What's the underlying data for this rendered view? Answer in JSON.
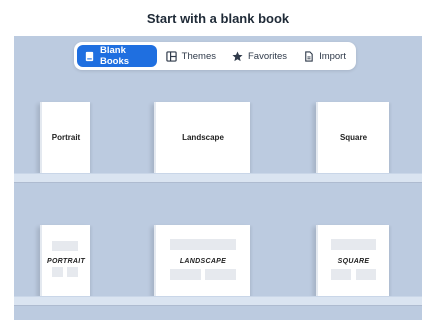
{
  "header": {
    "title": "Start with a blank book"
  },
  "tabs": [
    {
      "label": "Blank Books",
      "icon": "book-icon",
      "active": true
    },
    {
      "label": "Themes",
      "icon": "layout-grid-icon",
      "active": false
    },
    {
      "label": "Favorites",
      "icon": "star-icon",
      "active": false
    },
    {
      "label": "Import",
      "icon": "document-icon",
      "active": false
    }
  ],
  "shelf_top": {
    "books": [
      {
        "label": "Portrait"
      },
      {
        "label": "Landscape"
      },
      {
        "label": "Square"
      }
    ]
  },
  "shelf_bottom": {
    "books": [
      {
        "label": "PORTRAIT"
      },
      {
        "label": "LANDSCAPE"
      },
      {
        "label": "SQUARE"
      }
    ]
  },
  "colors": {
    "background": "#bccbe0",
    "accent": "#1f6fe0",
    "header_bg": "#ffffff"
  }
}
